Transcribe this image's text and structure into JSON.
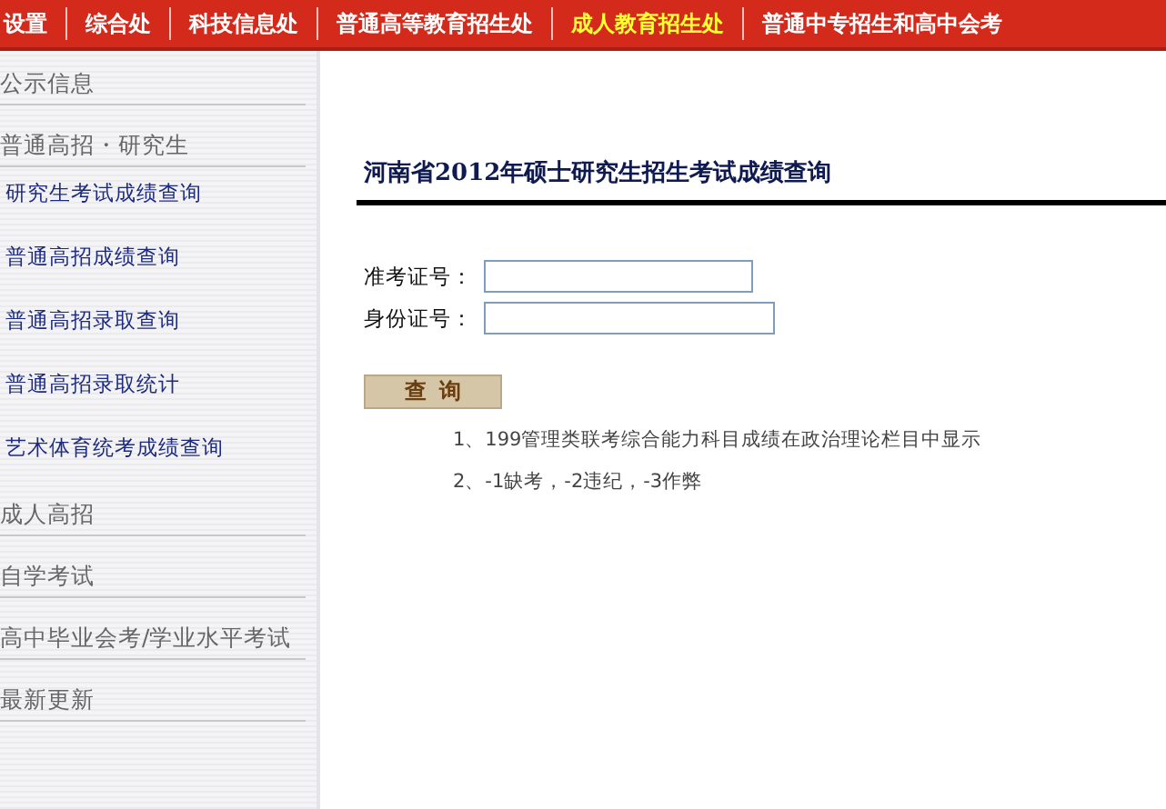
{
  "nav": [
    {
      "label": "设置",
      "selected": false
    },
    {
      "label": "综合处",
      "selected": false
    },
    {
      "label": "科技信息处",
      "selected": false
    },
    {
      "label": "普通高等教育招生处",
      "selected": false
    },
    {
      "label": "成人教育招生处",
      "selected": true
    },
    {
      "label": "普通中专招生和高中会考",
      "selected": false
    }
  ],
  "sidebar": {
    "items": [
      {
        "kind": "header",
        "label": "公示信息"
      },
      {
        "kind": "header",
        "label": "普通高招・研究生"
      },
      {
        "kind": "link",
        "label": "研究生考试成绩查询"
      },
      {
        "kind": "link",
        "label": "普通高招成绩查询"
      },
      {
        "kind": "link",
        "label": "普通高招录取查询"
      },
      {
        "kind": "link",
        "label": "普通高招录取统计"
      },
      {
        "kind": "link",
        "label": "艺术体育统考成绩查询"
      },
      {
        "kind": "header",
        "label": "成人高招"
      },
      {
        "kind": "header",
        "label": "自学考试"
      },
      {
        "kind": "header",
        "label": "高中毕业会考/学业水平考试"
      },
      {
        "kind": "header",
        "label": "最新更新"
      }
    ]
  },
  "main": {
    "title": "河南省2012年硕士研究生招生考试成绩查询",
    "fields": [
      {
        "label": "准考证号："
      },
      {
        "label": "身份证号："
      }
    ],
    "button": "查  询",
    "notes": [
      "1、199管理类联考综合能力科目成绩在政治理论栏目中显示",
      "2、-1缺考，-2违纪，-3作弊"
    ]
  }
}
